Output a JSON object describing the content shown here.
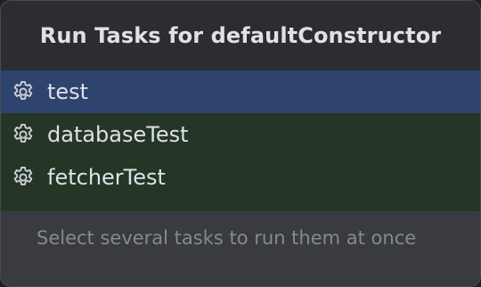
{
  "popup": {
    "title": "Run Tasks for defaultConstructor",
    "footer_hint": "Select several tasks to run them at once"
  },
  "tasks": [
    {
      "label": "test",
      "icon": "gear-icon",
      "selected": true
    },
    {
      "label": "databaseTest",
      "icon": "gear-icon",
      "selected": false
    },
    {
      "label": "fetcherTest",
      "icon": "gear-icon",
      "selected": false
    }
  ],
  "colors": {
    "background": "#2b2d30",
    "selected_row": "#2e436e",
    "list_background": "#253627",
    "footer_background": "#393b40",
    "text": "#dfe1e5",
    "hint_text": "#868991"
  }
}
